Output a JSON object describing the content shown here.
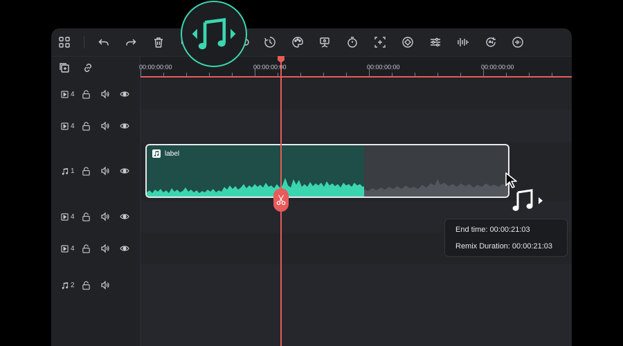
{
  "toolbar": {
    "icons": [
      "grid-icon",
      "undo-icon",
      "redo-icon",
      "delete-icon",
      "audio-remix-icon",
      "speed-icon",
      "color-icon",
      "freeze-icon",
      "timer-icon",
      "crop-icon",
      "keyframe-icon",
      "adjust-icon",
      "audio-beat-icon",
      "ai-voice-icon",
      "audio-stretch-icon"
    ]
  },
  "ruler": {
    "labels": [
      "00:00:00:00",
      "00:00:00:00",
      "00:00:00:00",
      "00:00:00:00"
    ]
  },
  "tracks": [
    {
      "type": "video",
      "number": "4",
      "muted_icon": "lock-icon"
    },
    {
      "type": "video",
      "number": "4"
    },
    {
      "type": "audio",
      "number": "1"
    },
    {
      "type": "video",
      "number": "4"
    },
    {
      "type": "video",
      "number": "4"
    },
    {
      "type": "audio",
      "number": "2"
    }
  ],
  "clip": {
    "label": "label",
    "color": "#3bd6b0"
  },
  "tooltip": {
    "end_time": "End time: 00:00:21:03",
    "remix_duration": "Remix Duration: 00:00:21:03"
  },
  "colors": {
    "accent": "#3bd6b0",
    "playhead": "#e75b5b",
    "background": "#1c1e22"
  }
}
